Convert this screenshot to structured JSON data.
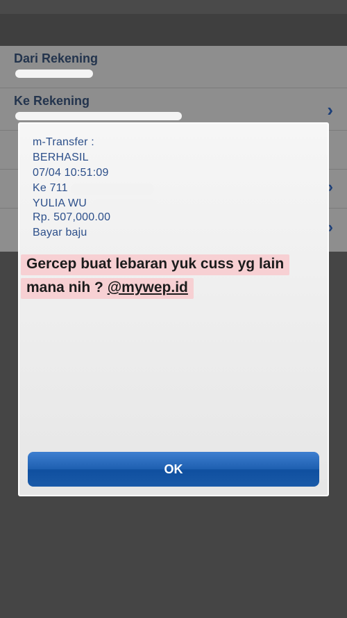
{
  "background": {
    "from_account_label": "Dari Rekening",
    "to_account_label": "Ke Rekening"
  },
  "dialog": {
    "lines": [
      "m-Transfer :",
      "BERHASIL",
      "07/04 10:51:09",
      "Ke 711",
      "YULIA WU",
      "Rp. 507,000.00",
      "Bayar baju"
    ],
    "ok_label": "OK"
  },
  "caption": {
    "line1": "Gercep buat lebaran yuk cuss yg lain",
    "line2_prefix": "mana nih ? ",
    "mention": "@mywep.id"
  },
  "colors": {
    "dialog_text": "#2c4f8a",
    "ok_button": "#1e5fb0",
    "caption_highlight": "#f7d0d3"
  }
}
